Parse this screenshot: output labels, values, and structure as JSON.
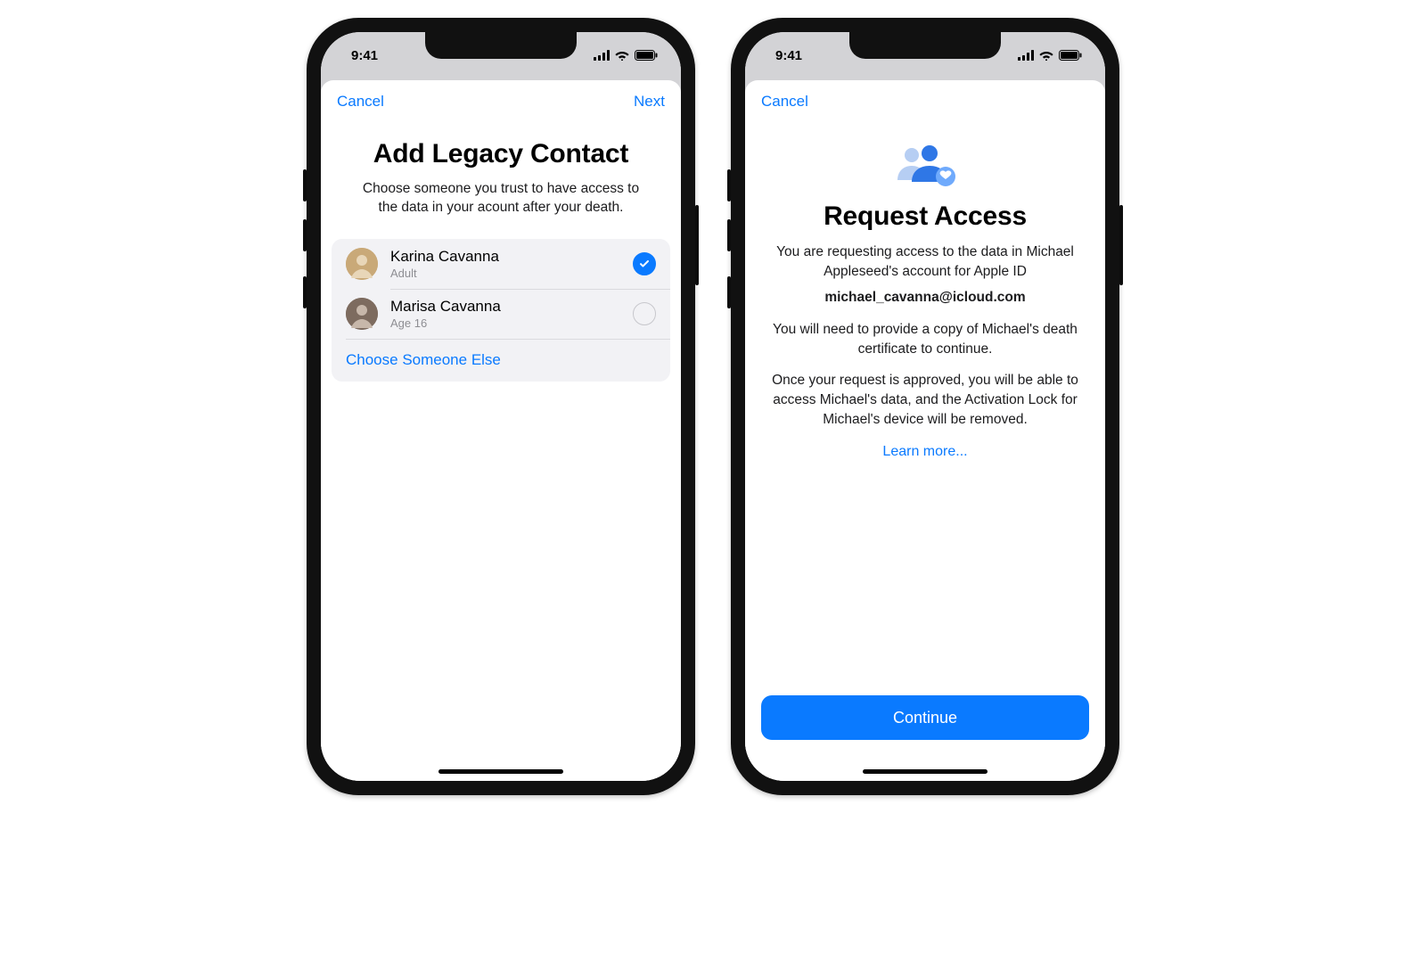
{
  "statusbar": {
    "time": "9:41"
  },
  "left": {
    "nav": {
      "cancel": "Cancel",
      "next": "Next"
    },
    "title": "Add Legacy Contact",
    "subtitle": "Choose someone you trust to have access to the data in your acount after your death.",
    "contacts": [
      {
        "name": "Karina Cavanna",
        "meta": "Adult",
        "selected": true
      },
      {
        "name": "Marisa Cavanna",
        "meta": "Age 16",
        "selected": false
      }
    ],
    "choose_else": "Choose Someone Else"
  },
  "right": {
    "nav": {
      "cancel": "Cancel"
    },
    "title": "Request Access",
    "body1a": "You are requesting access to the data in Michael Appleseed's account for Apple ID",
    "email": "michael_cavanna@icloud.com",
    "body2": "You will need to provide a copy of Michael's death certificate to continue.",
    "body3": "Once your request is approved, you will be able to access Michael's data, and the Activation Lock for Michael's device will be removed.",
    "learn_more": "Learn more...",
    "continue": "Continue"
  }
}
